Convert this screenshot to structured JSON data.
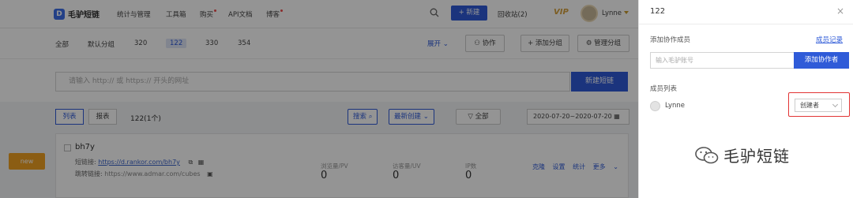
{
  "topbar": {
    "logo": "毛驴短链",
    "nav": [
      "统计与管理",
      "工具箱",
      "购买",
      "API文档",
      "博客"
    ],
    "new_button": "+ 新建",
    "recycle": "回收站(2)",
    "vip": "VIP",
    "user": "Lynne"
  },
  "groups": {
    "tabs": [
      "全部",
      "默认分组",
      "320",
      "122",
      "330",
      "354"
    ],
    "active": "122",
    "expand": "展开",
    "collab": "协作",
    "add_group": "+ 添加分组",
    "manage_group": "管理分组"
  },
  "url_bar": {
    "placeholder": "请输入 http:// 或 https:// 开头的网址",
    "create_button": "新建短链"
  },
  "list_toolbar": {
    "view_list": "列表",
    "view_report": "报表",
    "count": "122(1个)",
    "search": "搜索",
    "sort": "最新创建",
    "filter": "全部",
    "date_range": "2020-07-20~2020-07-20"
  },
  "card": {
    "tag": "new",
    "title": "bh7y",
    "short_label": "短链接:",
    "short_url": "https://d.rankor.com/bh7y",
    "redirect_label": "跳转链接:",
    "redirect_url": "https://www.admar.com/cubes",
    "stats": [
      {
        "label": "浏览量/PV",
        "value": "0"
      },
      {
        "label": "访客量/UV",
        "value": "0"
      },
      {
        "label": "IP数",
        "value": "0"
      }
    ],
    "actions": [
      "克隆",
      "设置",
      "统计",
      "更多"
    ]
  },
  "panel": {
    "title": "122",
    "add_label": "添加协作成员",
    "records_link": "成员记录",
    "input_placeholder": "输入毛驴账号",
    "add_button": "添加协作者",
    "members_label": "成员列表",
    "member_name": "Lynne",
    "member_role": "创建者"
  },
  "watermark": "毛驴短链",
  "colors": {
    "primary": "#2f5bd8",
    "highlight": "#e23434",
    "tag": "#f0a022"
  }
}
